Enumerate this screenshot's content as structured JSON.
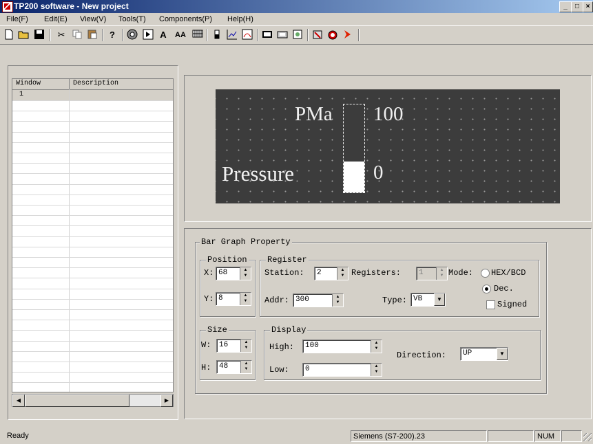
{
  "titlebar": {
    "title": "TP200 software - New project",
    "min": "_",
    "max": "□",
    "close": "×"
  },
  "menu": [
    "File(F)",
    "Edit(E)",
    "View(V)",
    "Tools(T)",
    "Components(P)",
    "Help(H)"
  ],
  "toolbar": {
    "icons": [
      "new-icon",
      "open-icon",
      "save-icon",
      "cut-icon",
      "copy-icon",
      "paste-icon",
      "help-icon",
      "target-icon",
      "play-icon",
      "text-icon",
      "double-text-icon",
      "grid-icon",
      "bargraph-icon",
      "trend-icon",
      "meter-icon",
      "frame-icon",
      "button-icon",
      "image-icon",
      "alarm-icon",
      "clock-icon",
      "arrow-icon"
    ],
    "text_a": "A",
    "text_aa": "AA"
  },
  "window_list": {
    "columns": [
      "Window",
      "Description"
    ],
    "rows": [
      {
        "window": "1",
        "description": ""
      }
    ]
  },
  "lcd": {
    "unit": "PMa",
    "high_value": "100",
    "label": "Pressure",
    "low_value": "0",
    "bar_fill_fraction": 0.35
  },
  "bar_graph_property": {
    "title": "Bar Graph Property",
    "position": {
      "title": "Position",
      "x_label": "X:",
      "x": "68",
      "y_label": "Y:",
      "y": "8"
    },
    "register": {
      "title": "Register",
      "station_label": "Station:",
      "station": "2",
      "registers_label": "Registers:",
      "registers": "1",
      "mode_label": "Mode:",
      "mode_options": [
        "HEX/BCD",
        "Dec."
      ],
      "mode_selected": "Dec.",
      "signed_label": "Signed",
      "addr_label": "Addr:",
      "addr": "300",
      "type_label": "Type:",
      "type": "VB"
    },
    "size": {
      "title": "Size",
      "w_label": "W:",
      "w": "16",
      "h_label": "H:",
      "h": "48"
    },
    "display": {
      "title": "Display",
      "high_label": "High:",
      "high": "100",
      "low_label": "Low:",
      "low": "0",
      "direction_label": "Direction:",
      "direction": "UP"
    }
  },
  "statusbar": {
    "status": "Ready",
    "plc": "Siemens (S7-200).23",
    "num": "NUM"
  }
}
